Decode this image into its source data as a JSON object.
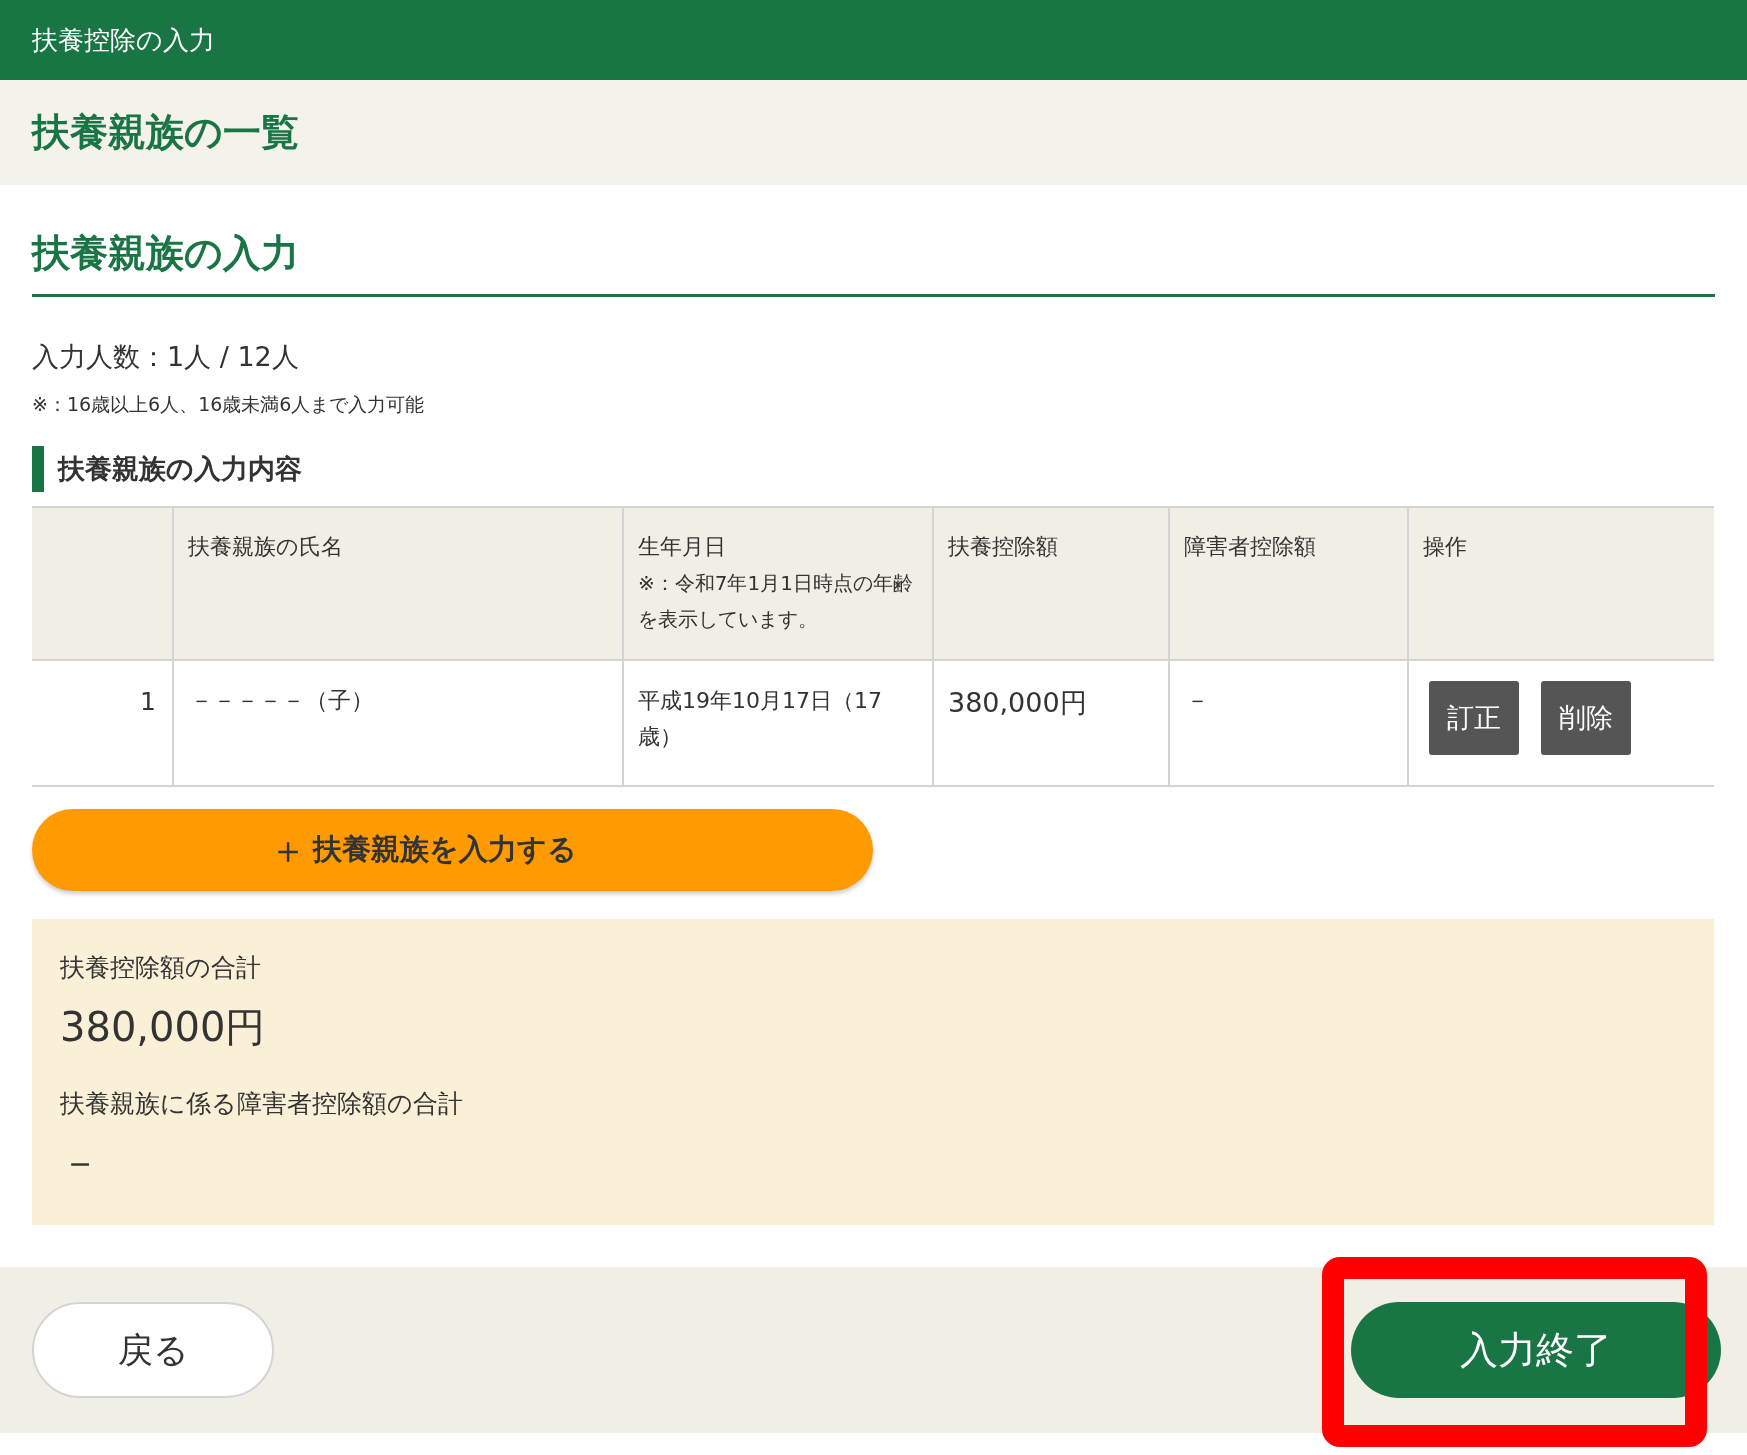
{
  "header": {
    "title": "扶養控除の入力"
  },
  "page_title": "扶養親族の一覧",
  "section_title": "扶養親族の入力",
  "count_text": "入力人数：1人 / 12人",
  "count_note": "※：16歳以上6人、16歳未満6人まで入力可能",
  "list_heading": "扶養親族の入力内容",
  "table": {
    "columns": [
      {},
      {
        "label": "扶養親族の氏名"
      },
      {
        "label": "生年月日",
        "note": "※：令和7年1月1日時点の年齢を表示しています。"
      },
      {
        "label": "扶養控除額"
      },
      {
        "label": "障害者控除額"
      },
      {
        "label": "操作"
      }
    ],
    "rows": [
      {
        "number": "1",
        "name": "－－－－－（子）",
        "birth": "平成19年10月17日（17歳）",
        "dependent_deduction": "380,000円",
        "disability_deduction": "－",
        "actions": [
          "訂正",
          "削除"
        ]
      }
    ]
  },
  "add_button": {
    "icon": "＋",
    "label": "扶養親族を入力する"
  },
  "summary": [
    {
      "label": "扶養控除額の合計",
      "value": "380,000円"
    },
    {
      "label": "扶養親族に係る障害者控除額の合計",
      "value": "－"
    }
  ],
  "footer": {
    "back_button": "戻る",
    "finish_button": "入力終了",
    "finish_highlighted": true
  }
}
